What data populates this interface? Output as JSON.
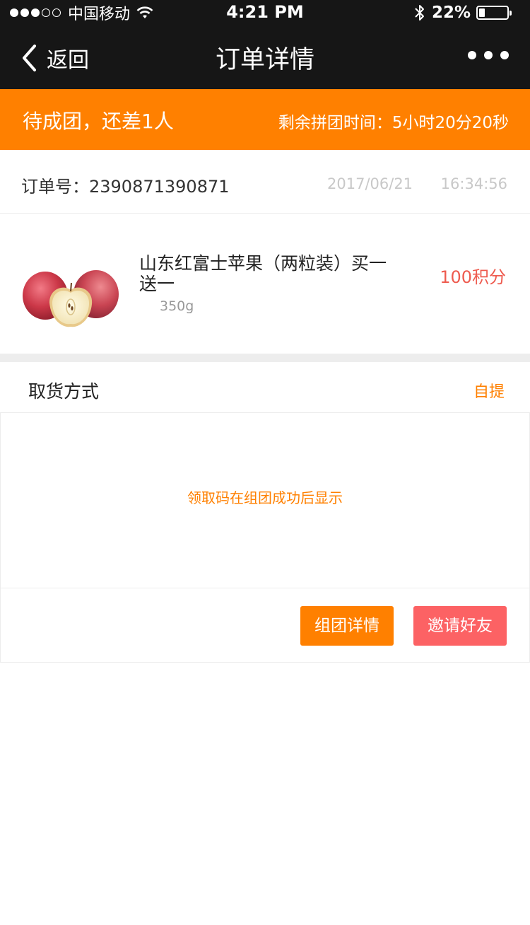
{
  "status_bar": {
    "carrier": "中国移动",
    "time": "4:21 PM",
    "battery_percent": "22%",
    "battery_level": 0.22,
    "signal_bars": 3,
    "signal_total": 5
  },
  "nav": {
    "back_label": "返回",
    "title": "订单详情",
    "more_icon": "more-dots-icon"
  },
  "group_banner": {
    "status": "待成团，还差1人",
    "countdown": "剩余拼团时间：5小时20分20秒",
    "color": "#ff8000"
  },
  "order": {
    "number_label": "订单号：2390871390871",
    "date": "2017/06/21",
    "time": "16:34:56"
  },
  "product": {
    "name": "山东红富士苹果（两粒装）买一送一",
    "spec": "350g",
    "points": "100积分",
    "image_icon": "apple-image"
  },
  "pickup": {
    "label": "取货方式",
    "value": "自提",
    "code_note": "领取码在组团成功后显示"
  },
  "actions": {
    "group_detail": "组团详情",
    "invite_friends": "邀请好友"
  },
  "colors": {
    "nav_bg": "#161616",
    "accent": "#ff8000",
    "invite": "#fc6264",
    "points": "#ee5b4f"
  }
}
